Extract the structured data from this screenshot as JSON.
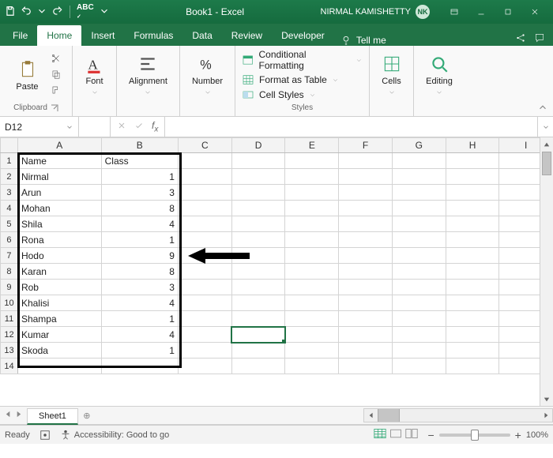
{
  "title": "Book1 - Excel",
  "user": {
    "name": "NIRMAL KAMISHETTY",
    "initials": "NK"
  },
  "tabs": {
    "file": "File",
    "home": "Home",
    "insert": "Insert",
    "formulas": "Formulas",
    "data": "Data",
    "review": "Review",
    "developer": "Developer",
    "tellme": "Tell me"
  },
  "ribbon": {
    "paste": "Paste",
    "clipboard": "Clipboard",
    "font": "Font",
    "alignment": "Alignment",
    "number": "Number",
    "cond_fmt": "Conditional Formatting",
    "fmt_table": "Format as Table",
    "cell_styles": "Cell Styles",
    "styles": "Styles",
    "cells": "Cells",
    "editing": "Editing"
  },
  "namebox": "D12",
  "columns": [
    "A",
    "B",
    "C",
    "D",
    "E",
    "F",
    "G",
    "H",
    "I"
  ],
  "headers": {
    "A": "Name",
    "B": "Class"
  },
  "rows": [
    {
      "name": "Nirmal",
      "class": 1
    },
    {
      "name": "Arun",
      "class": 3
    },
    {
      "name": "Mohan",
      "class": 8
    },
    {
      "name": "Shila",
      "class": 4
    },
    {
      "name": "Rona",
      "class": 1
    },
    {
      "name": "Hodo",
      "class": 9
    },
    {
      "name": "Karan",
      "class": 8
    },
    {
      "name": "Rob",
      "class": 3
    },
    {
      "name": "Khalisi",
      "class": 4
    },
    {
      "name": "Shampa",
      "class": 1
    },
    {
      "name": "Kumar",
      "class": 4
    },
    {
      "name": "Skoda",
      "class": 1
    }
  ],
  "sheet_tab": "Sheet1",
  "status": {
    "ready": "Ready",
    "accessibility": "Accessibility: Good to go",
    "zoom": "100%"
  }
}
